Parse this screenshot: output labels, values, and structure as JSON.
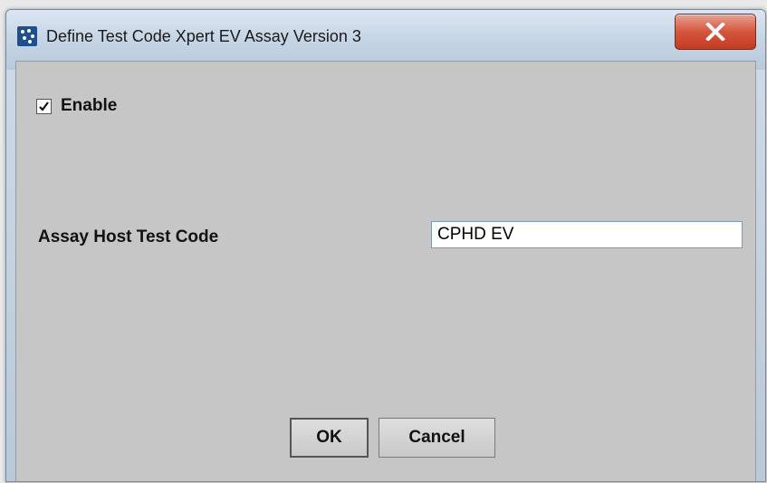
{
  "window": {
    "title": "Define Test Code Xpert EV Assay Version 3",
    "close_icon": "close-x-icon",
    "app_icon": "app-logo-icon"
  },
  "form": {
    "enable_label": "Enable",
    "enable_checked": true,
    "host_test_code_label": "Assay Host Test Code",
    "host_test_code_value": "CPHD EV"
  },
  "buttons": {
    "ok_label": "OK",
    "cancel_label": "Cancel"
  },
  "colors": {
    "close_button": "#c23b22",
    "dialog_background": "#c6c6c6",
    "titlebar": "#c7d6e6"
  }
}
